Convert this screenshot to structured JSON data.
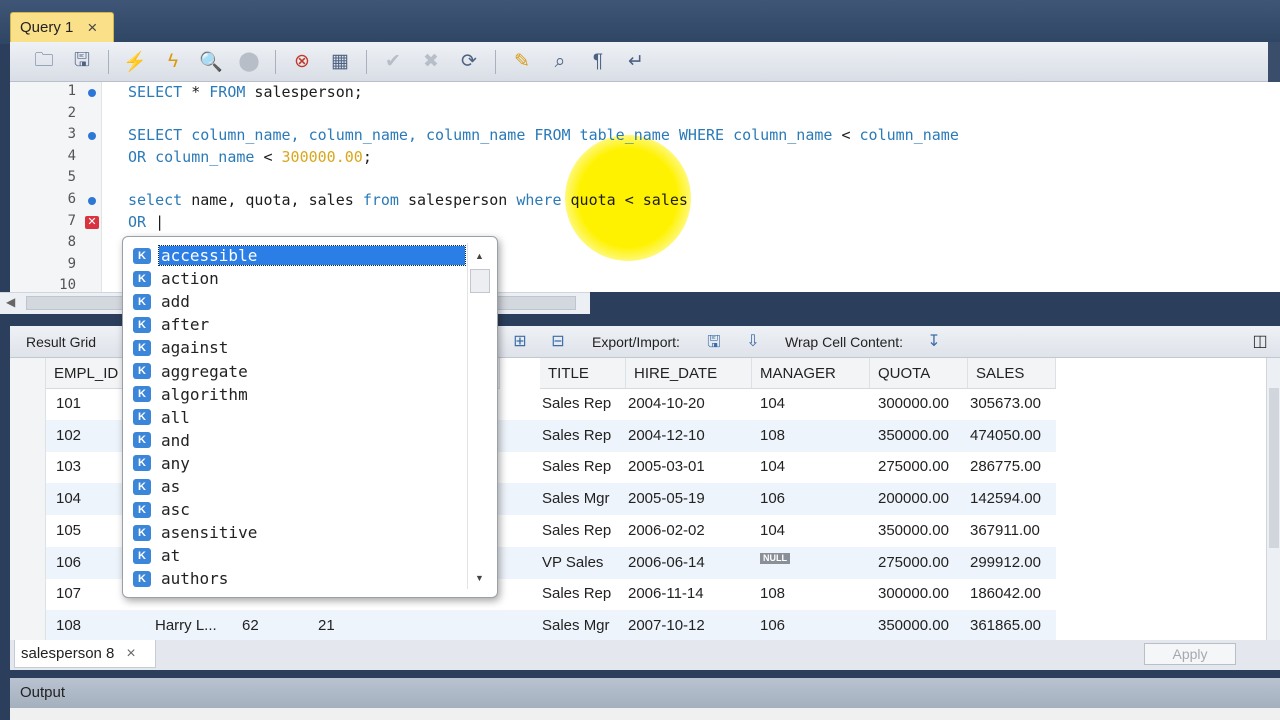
{
  "query_tab": {
    "label": "Query 1",
    "close": "×"
  },
  "toolbar": {
    "icons": [
      "open-folder-icon",
      "save-icon",
      "execute-icon",
      "execute-current-icon",
      "explain-icon",
      "stop-icon",
      "toggle-error-icon",
      "toggle-result-icon",
      "commit-icon",
      "rollback-icon",
      "autocommit-icon",
      "beautify-icon",
      "find-icon",
      "invisible-chars-icon",
      "wrap-icon"
    ]
  },
  "editor": {
    "line_numbers": [
      "1",
      "2",
      "3",
      "4",
      "5",
      "6",
      "7",
      "8",
      "9",
      "10"
    ],
    "lines": [
      [
        {
          "t": "SELECT",
          "c": "kw"
        },
        {
          "t": " * ",
          "c": ""
        },
        {
          "t": "FROM",
          "c": "kw"
        },
        {
          "t": " salesperson;",
          "c": ""
        }
      ],
      [],
      [
        {
          "t": "SELECT column_name, column_name, column_name ",
          "c": "kw"
        },
        {
          "t": "FROM",
          "c": "kw"
        },
        {
          "t": " table_name ",
          "c": "kw"
        },
        {
          "t": "WHERE",
          "c": "kw"
        },
        {
          "t": " column_name ",
          "c": "kw"
        },
        {
          "t": "<",
          "c": ""
        },
        {
          "t": " column_name",
          "c": "kw"
        }
      ],
      [
        {
          "t": "OR column_name ",
          "c": "kw"
        },
        {
          "t": "<",
          "c": ""
        },
        {
          "t": " ",
          "c": ""
        },
        {
          "t": "300000.00",
          "c": "num"
        },
        {
          "t": ";",
          "c": ""
        }
      ],
      [],
      [
        {
          "t": "select",
          "c": "kw"
        },
        {
          "t": " name, quota, sales ",
          "c": ""
        },
        {
          "t": "from",
          "c": "kw"
        },
        {
          "t": " salesperson ",
          "c": ""
        },
        {
          "t": "where",
          "c": "kw"
        },
        {
          "t": " quota < sales",
          "c": ""
        }
      ],
      [
        {
          "t": "OR",
          "c": "kw"
        },
        {
          "t": " |",
          "c": ""
        }
      ],
      [],
      [],
      []
    ]
  },
  "result_toolbar": {
    "result_grid": "Result Grid",
    "export_import": "Export/Import:",
    "wrap_cell": "Wrap Cell Content:"
  },
  "grid": {
    "columns": [
      "EMPL_ID",
      "TITLE",
      "HIRE_DATE",
      "MANAGER",
      "QUOTA",
      "SALES"
    ],
    "rows": [
      {
        "id": "101",
        "name": "",
        "c3": "",
        "c4": "",
        "title": "Sales Rep",
        "hire": "2004-10-20",
        "mgr": "104",
        "quota": "300000.00",
        "sales": "305673.00"
      },
      {
        "id": "102",
        "name": "",
        "c3": "",
        "c4": "",
        "title": "Sales Rep",
        "hire": "2004-12-10",
        "mgr": "108",
        "quota": "350000.00",
        "sales": "474050.00"
      },
      {
        "id": "103",
        "name": "",
        "c3": "",
        "c4": "",
        "title": "Sales Rep",
        "hire": "2005-03-01",
        "mgr": "104",
        "quota": "275000.00",
        "sales": "286775.00"
      },
      {
        "id": "104",
        "name": "",
        "c3": "",
        "c4": "",
        "title": "Sales Mgr",
        "hire": "2005-05-19",
        "mgr": "106",
        "quota": "200000.00",
        "sales": "142594.00"
      },
      {
        "id": "105",
        "name": "",
        "c3": "",
        "c4": "",
        "title": "Sales Rep",
        "hire": "2006-02-02",
        "mgr": "104",
        "quota": "350000.00",
        "sales": "367911.00"
      },
      {
        "id": "106",
        "name": "",
        "c3": "",
        "c4": "",
        "title": "VP Sales",
        "hire": "2006-06-14",
        "mgr": "NULL",
        "quota": "275000.00",
        "sales": "299912.00"
      },
      {
        "id": "107",
        "name": "",
        "c3": "",
        "c4": "",
        "title": "Sales Rep",
        "hire": "2006-11-14",
        "mgr": "108",
        "quota": "300000.00",
        "sales": "186042.00"
      },
      {
        "id": "108",
        "name": "Harry L...",
        "c3": "62",
        "c4": "21",
        "title": "Sales Mgr",
        "hire": "2007-10-12",
        "mgr": "106",
        "quota": "350000.00",
        "sales": "361865.00"
      }
    ]
  },
  "result_tab": {
    "label": "salesperson 8",
    "close": "×"
  },
  "apply_button": "Apply",
  "output": {
    "label": "Output"
  },
  "autocomplete": {
    "badge": "K",
    "items": [
      "accessible",
      "action",
      "add",
      "after",
      "against",
      "aggregate",
      "algorithm",
      "all",
      "and",
      "any",
      "as",
      "asc",
      "asensitive",
      "at",
      "authors"
    ],
    "selected_index": 0
  }
}
